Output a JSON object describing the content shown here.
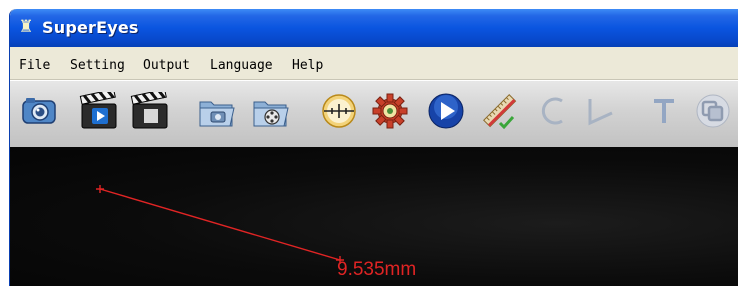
{
  "window": {
    "title": "SuperEyes",
    "app_icon": "microscope-icon"
  },
  "menu": {
    "items": [
      {
        "label": "File"
      },
      {
        "label": "Setting"
      },
      {
        "label": "Output"
      },
      {
        "label": "Language"
      },
      {
        "label": "Help"
      }
    ]
  },
  "toolbar": {
    "tools": [
      {
        "icon": "camera-icon"
      },
      {
        "icon": "record-video-icon"
      },
      {
        "icon": "stop-video-icon"
      },
      {
        "icon": "open-photos-folder-icon"
      },
      {
        "icon": "open-videos-folder-icon"
      },
      {
        "icon": "crosshair-icon"
      },
      {
        "icon": "settings-gear-icon"
      },
      {
        "icon": "play-icon"
      },
      {
        "icon": "ruler-calibrate-icon"
      },
      {
        "icon": "arc-tool-icon"
      },
      {
        "icon": "angle-tool-icon"
      },
      {
        "icon": "text-tool-icon"
      },
      {
        "icon": "overlay-tool-icon"
      }
    ]
  },
  "viewport": {
    "measurement": {
      "value_label": "9.535mm"
    }
  },
  "colors": {
    "title_bar": "#0a55e0",
    "menu_bg": "#ece9d8",
    "viewport_bg": "#0b0b0b",
    "measure_line": "#e02424"
  }
}
